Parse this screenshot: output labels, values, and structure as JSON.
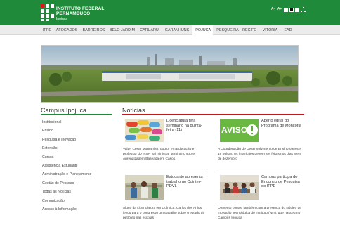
{
  "header": {
    "brand_line1": "INSTITUTO FEDERAL",
    "brand_line2": "PERNAMBUCO",
    "brand_line3": "Ipojuca",
    "font_increase": "A+",
    "font_decrease": "A-",
    "contrast_icons": [
      "white-square-icon",
      "black-square-icon",
      "white-square-icon",
      "sitemap-icon"
    ],
    "colors": {
      "green": "#1f8a3a",
      "red": "#d61b1b"
    }
  },
  "nav": {
    "items": [
      "IFPE",
      "AFOGADOS",
      "BARREIROS",
      "BELO JARDIM",
      "CARUARU",
      "GARANHUNS",
      "IPOJUCA",
      "PESQUEIRA",
      "RECIFE",
      "VITÓRIA",
      "EAD"
    ],
    "active": "IPOJUCA"
  },
  "sidebar": {
    "title": "Campus Ipojuca",
    "items": [
      "Institucional",
      "Ensino",
      "Pesquisa e Inovação",
      "Extensão",
      "Cursos",
      "Assistência Estudantil",
      "Administração e Planejamento",
      "Gestão de Pessoas",
      "Todas as Notícias",
      "Comunicação",
      "Acesso à Informação"
    ]
  },
  "news": {
    "title": "Notícias",
    "cards": [
      {
        "title": "Licenciatura terá seminário na quinta-feira (11)",
        "text": "Valter Cesar Montanher, doutor em Educação e professor do IFSP, vai ministrar seminário sobre Aprendizagem Baseada em Casos",
        "thumb": "medicine-capsules-photo"
      },
      {
        "title": "Aberto edital do Programa de Monitoria",
        "text": "A Coordenação de Desenvolvimento de Ensino oferece 16 bolsas. As inscrições devem ser feitas nos dias 8 e 9 de dezembro",
        "thumb": "aviso-banner",
        "thumb_text": "AVISO"
      },
      {
        "title": "Estudante apresenta trabalho no Cointer-PDVL",
        "text": "Aluno da Licenciatura em Química, Carlos dos Anjos levou para o congresso um trabalho sobre o estudo do petróleo nas escolas",
        "thumb": "student-presentation-photo"
      },
      {
        "title": "Campus participa do I Encontro de Pesquisa do IFPE",
        "text": "O evento contou também com a presença do Núcleo de Inovação Tecnológica do Instituto (NIT), que nasceu no Campus Ipojuca",
        "thumb": "meeting-room-photo"
      }
    ],
    "rule_color": "#c21a1a"
  }
}
